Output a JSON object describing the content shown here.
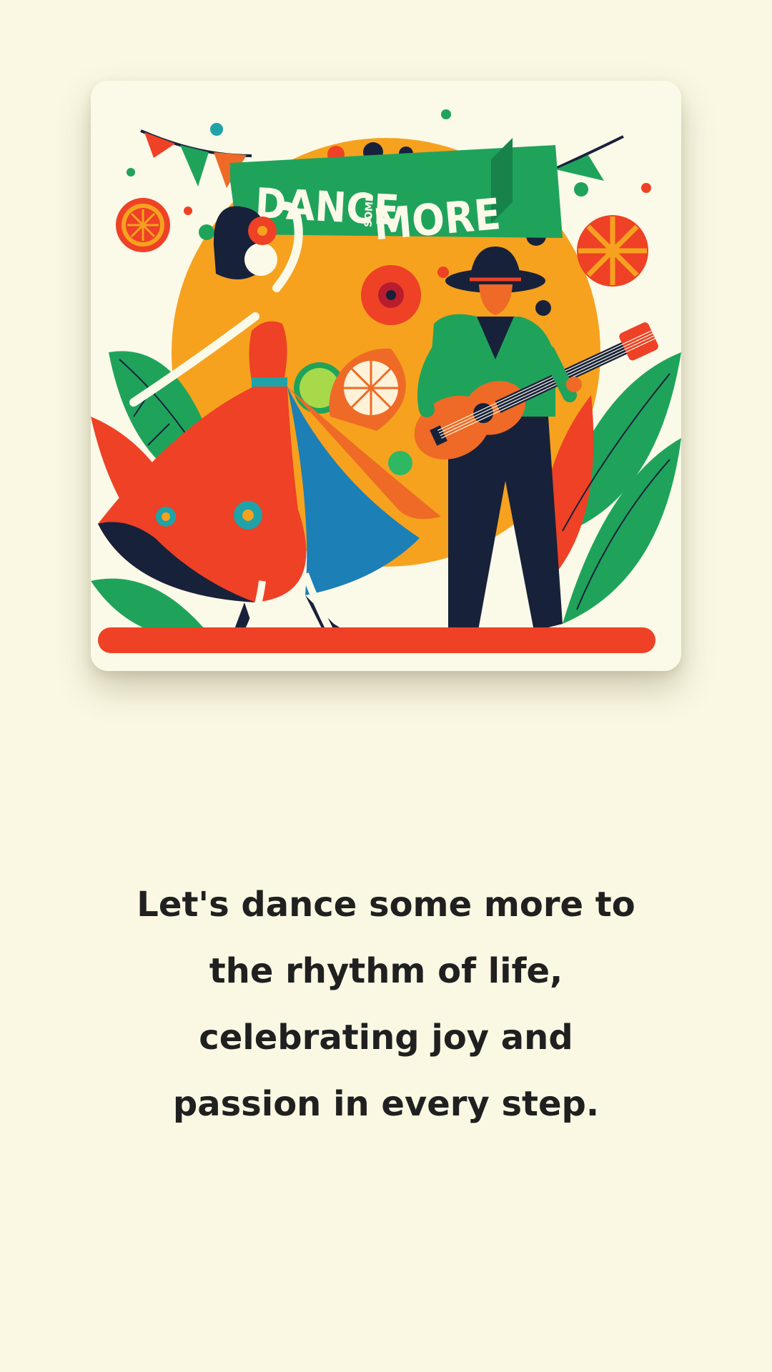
{
  "artwork": {
    "banner_text_left": "DANCE",
    "banner_text_small": "SOME",
    "banner_text_right": "MORE",
    "colors": {
      "background": "#FAF8E3",
      "card": "#FBF9E8",
      "sun": "#F6A21E",
      "green": "#1FA35B",
      "red": "#EE4126",
      "navy": "#17213A",
      "blue": "#1C7FB5"
    }
  },
  "caption": {
    "lines": [
      "Let's dance some more to",
      "the rhythm of life,",
      "celebrating joy and",
      "passion in every step."
    ]
  }
}
